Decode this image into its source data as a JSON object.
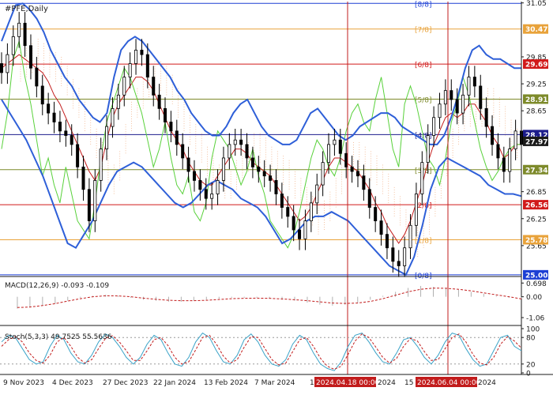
{
  "chart_data": [
    {
      "type": "candlestick",
      "title": "#PFE,Daily",
      "price_axis": [
        31.05,
        30.47,
        29.85,
        29.69,
        29.25,
        28.91,
        28.65,
        28.12,
        27.97,
        27.34,
        26.85,
        26.56,
        26.25,
        25.78,
        25.65,
        25.0
      ],
      "ylim": [
        24.98,
        31.08
      ],
      "dates": [
        "9 Nov 2023",
        "4 Dec 2023",
        "27 Dec 2023",
        "22 Jan 2024",
        "13 Feb 2024",
        "7 Mar 2024",
        "1 Apr 2024",
        "2024.04.18 00:00",
        "2024",
        "15",
        "2024.06.04 00:00",
        "2024"
      ],
      "levels": [
        {
          "label": "[8/8]",
          "value": 31.04,
          "color": "#1c3fd4"
        },
        {
          "label": "[7/8]",
          "value": 30.47,
          "color": "#e8a23a"
        },
        {
          "label": "[6/8]",
          "value": 29.69,
          "color": "#d11a1a"
        },
        {
          "label": "[5/8]",
          "value": 28.91,
          "color": "#7d8a2a"
        },
        {
          "label": "[4/8]",
          "value": 28.12,
          "color": "#1c1c8c"
        },
        {
          "label": "[3/8]",
          "value": 27.34,
          "color": "#7d8a2a"
        },
        {
          "label": "[2/8]",
          "value": 26.56,
          "color": "#d11a1a"
        },
        {
          "label": "[1/8]",
          "value": 25.78,
          "color": "#e8a23a"
        },
        {
          "label": "[0/8]",
          "value": 25.0,
          "color": "#1c3fd4"
        }
      ],
      "price_tags": [
        {
          "value": 30.47,
          "color": "#e8a23a"
        },
        {
          "value": 29.69,
          "color": "#d11a1a"
        },
        {
          "value": 28.91,
          "color": "#7d8a2a"
        },
        {
          "value": 28.12,
          "color": "#1c1c8c"
        },
        {
          "value": 27.97,
          "color": "#1a1a1a"
        },
        {
          "value": 27.34,
          "color": "#7d8a2a"
        },
        {
          "value": 26.56,
          "color": "#d11a1a"
        },
        {
          "value": 25.78,
          "color": "#e8a23a"
        },
        {
          "value": 25.0,
          "color": "#1c3fd4"
        }
      ],
      "plain_ticks": [
        31.05,
        29.85,
        29.25,
        28.65,
        26.85,
        26.25,
        25.65
      ],
      "series": [
        {
          "name": "close",
          "values": [
            29.5,
            29.9,
            30.3,
            30.6,
            30.1,
            29.6,
            29.2,
            28.8,
            28.6,
            28.4,
            28.2,
            28.1,
            27.9,
            27.4,
            26.9,
            26.2,
            27.1,
            27.8,
            28.3,
            28.7,
            29.0,
            29.4,
            29.7,
            30.0,
            29.9,
            29.4,
            29.0,
            28.7,
            28.4,
            28.2,
            27.9,
            27.6,
            27.3,
            27.1,
            26.9,
            26.7,
            26.8,
            27.1,
            27.6,
            27.9,
            28.0,
            27.9,
            27.6,
            27.4,
            27.3,
            27.2,
            27.1,
            26.8,
            26.5,
            26.3,
            26.0,
            25.8,
            26.2,
            26.6,
            27.0,
            27.5,
            27.9,
            28.0,
            27.7,
            27.4,
            27.3,
            27.2,
            26.9,
            26.5,
            26.2,
            25.9,
            25.6,
            25.3,
            25.2,
            25.6,
            26.1,
            26.8,
            27.5,
            28.1,
            28.5,
            28.8,
            29.1,
            28.9,
            28.6,
            29.0,
            29.4,
            29.2,
            28.7,
            28.3,
            27.9,
            27.6,
            27.3,
            27.8,
            28.2,
            27.9
          ]
        },
        {
          "name": "ichimoku",
          "values": [
            29.6,
            29.7,
            29.8,
            29.9,
            29.8,
            29.7,
            29.6,
            29.5,
            29.3,
            29.0,
            28.8,
            28.5,
            28.2,
            27.9,
            27.6,
            27.3,
            27.1,
            27.4,
            28.0,
            28.5,
            28.8,
            29.0,
            29.2,
            29.4,
            29.4,
            29.3,
            29.1,
            28.8,
            28.5,
            28.2,
            28.0,
            27.8,
            27.5,
            27.3,
            27.1,
            27.0,
            27.0,
            27.2,
            27.4,
            27.6,
            27.8,
            27.8,
            27.7,
            27.5,
            27.4,
            27.3,
            27.2,
            27.0,
            26.8,
            26.6,
            26.4,
            26.2,
            26.3,
            26.5,
            26.8,
            27.1,
            27.4,
            27.6,
            27.6,
            27.5,
            27.4,
            27.3,
            27.1,
            26.9,
            26.6,
            26.4,
            26.1,
            25.9,
            25.7,
            25.9,
            26.2,
            26.6,
            27.0,
            27.5,
            27.9,
            28.2,
            28.5,
            28.6,
            28.5,
            28.6,
            28.8,
            28.8,
            28.6,
            28.4,
            28.1,
            27.9,
            27.6,
            27.7,
            27.9,
            27.9
          ]
        },
        {
          "name": "momentum",
          "values": [
            27.8,
            28.6,
            29.8,
            30.2,
            29.4,
            28.8,
            28.0,
            27.2,
            27.6,
            27.0,
            26.6,
            27.4,
            26.8,
            26.2,
            26.0,
            25.8,
            26.6,
            27.6,
            28.4,
            28.8,
            29.2,
            29.6,
            29.4,
            29.0,
            28.6,
            28.0,
            27.4,
            27.8,
            28.4,
            27.6,
            27.0,
            26.8,
            27.2,
            26.4,
            26.2,
            26.6,
            27.6,
            28.2,
            28.0,
            27.8,
            27.4,
            27.0,
            27.3,
            27.8,
            27.2,
            26.8,
            26.2,
            26.0,
            25.8,
            25.6,
            25.9,
            26.4,
            27.0,
            27.6,
            28.0,
            27.8,
            27.4,
            27.2,
            27.6,
            28.2,
            28.6,
            28.8,
            28.4,
            28.2,
            28.9,
            29.4,
            28.6,
            27.8,
            27.4,
            28.8,
            29.2,
            28.8,
            28.2,
            27.6,
            27.4,
            27.0,
            27.6,
            28.4,
            28.8,
            29.4,
            29.0,
            28.4,
            27.8,
            27.4,
            27.1,
            27.3,
            27.6,
            27.8,
            27.9,
            27.9
          ]
        },
        {
          "name": "bollinger_upper",
          "values": [
            30.2,
            30.6,
            31.0,
            31.04,
            30.9,
            30.7,
            30.4,
            30.0,
            29.7,
            29.4,
            29.2,
            28.9,
            28.7,
            28.5,
            28.4,
            28.6,
            29.4,
            30.0,
            30.2,
            30.3,
            30.2,
            30.0,
            29.8,
            29.6,
            29.4,
            29.1,
            28.9,
            28.6,
            28.4,
            28.2,
            28.1,
            28.1,
            28.3,
            28.6,
            28.8,
            28.9,
            28.6,
            28.3,
            28.1,
            28.0,
            27.9,
            27.9,
            28.0,
            28.3,
            28.6,
            28.7,
            28.5,
            28.3,
            28.1,
            28.0,
            28.1,
            28.3,
            28.4,
            28.5,
            28.6,
            28.6,
            28.5,
            28.3,
            28.2,
            28.1,
            28.0,
            27.9,
            27.9,
            28.1,
            28.5,
            29.0,
            29.6,
            30.0,
            30.1,
            29.9,
            29.8,
            29.8,
            29.7,
            29.6,
            29.6
          ]
        },
        {
          "name": "bollinger_lower",
          "values": [
            28.9,
            28.6,
            28.3,
            28.0,
            27.6,
            27.2,
            26.7,
            26.2,
            25.7,
            25.6,
            25.9,
            26.2,
            26.6,
            27.0,
            27.3,
            27.4,
            27.5,
            27.4,
            27.2,
            27.0,
            26.8,
            26.6,
            26.5,
            26.6,
            26.8,
            27.0,
            27.1,
            27.0,
            26.9,
            26.7,
            26.6,
            26.5,
            26.3,
            26.0,
            25.7,
            25.8,
            26.0,
            26.2,
            26.3,
            26.3,
            26.4,
            26.3,
            26.2,
            26.0,
            25.8,
            25.6,
            25.4,
            25.2,
            25.1,
            25.0,
            25.4,
            26.1,
            26.9,
            27.4,
            27.6,
            27.5,
            27.4,
            27.3,
            27.2,
            27.0,
            26.9,
            26.8,
            26.8,
            26.75
          ]
        }
      ]
    },
    {
      "type": "bar",
      "title": "MACD(12,26,9) -0.093 -0.109",
      "axis": [
        0.698,
        0.0,
        -1.06
      ],
      "ylim": [
        -1.3,
        0.95
      ],
      "series": [
        {
          "name": "histogram",
          "values": [
            -0.6,
            -0.55,
            -0.45,
            -0.35,
            -0.2,
            -0.05,
            0.05,
            0.1,
            0.05,
            -0.05,
            -0.15,
            -0.2,
            -0.25,
            -0.25,
            -0.2,
            -0.15,
            -0.1,
            -0.05,
            -0.05,
            -0.05,
            -0.1,
            -0.15,
            -0.2,
            -0.3,
            -0.4,
            -0.45,
            -0.4,
            -0.3,
            -0.15,
            0.05,
            0.25,
            0.45,
            0.55,
            0.5,
            0.45,
            0.35,
            0.25,
            0.15,
            0.05,
            -0.05,
            -0.09
          ]
        },
        {
          "name": "signal",
          "values": [
            -0.55,
            -0.52,
            -0.45,
            -0.35,
            -0.22,
            -0.1,
            0.0,
            0.05,
            0.04,
            0.0,
            -0.07,
            -0.13,
            -0.18,
            -0.2,
            -0.2,
            -0.18,
            -0.14,
            -0.1,
            -0.08,
            -0.07,
            -0.08,
            -0.11,
            -0.15,
            -0.2,
            -0.26,
            -0.32,
            -0.34,
            -0.32,
            -0.24,
            -0.1,
            0.08,
            0.25,
            0.38,
            0.44,
            0.43,
            0.38,
            0.3,
            0.2,
            0.1,
            0.0,
            -0.11
          ]
        }
      ]
    },
    {
      "type": "line",
      "title": "Stoch(5,3,3) 49.7525 55.5636",
      "axis": [
        100,
        80,
        20,
        0
      ],
      "ylim": [
        0,
        100
      ],
      "series": [
        {
          "name": "%K",
          "values": [
            70,
            85,
            80,
            55,
            30,
            20,
            25,
            60,
            85,
            75,
            45,
            25,
            20,
            40,
            70,
            88,
            80,
            60,
            35,
            20,
            35,
            65,
            85,
            75,
            45,
            20,
            15,
            35,
            70,
            90,
            80,
            50,
            25,
            20,
            40,
            75,
            88,
            70,
            40,
            20,
            15,
            30,
            65,
            85,
            75,
            45,
            20,
            10,
            5,
            25,
            60,
            85,
            90,
            70,
            45,
            25,
            20,
            45,
            75,
            80,
            60,
            35,
            20,
            40,
            70,
            90,
            85,
            55,
            30,
            15,
            20,
            50,
            80,
            85,
            60,
            50
          ]
        },
        {
          "name": "%D",
          "values": [
            60,
            75,
            82,
            70,
            45,
            28,
            22,
            40,
            70,
            80,
            60,
            35,
            22,
            30,
            55,
            78,
            84,
            70,
            50,
            28,
            28,
            50,
            75,
            80,
            62,
            35,
            20,
            25,
            52,
            80,
            85,
            65,
            38,
            22,
            30,
            58,
            82,
            80,
            55,
            30,
            18,
            22,
            48,
            75,
            80,
            60,
            33,
            15,
            8,
            15,
            42,
            72,
            88,
            80,
            58,
            35,
            22,
            33,
            60,
            78,
            72,
            48,
            28,
            30,
            55,
            80,
            88,
            70,
            42,
            22,
            18,
            35,
            65,
            82,
            72,
            56
          ]
        }
      ]
    }
  ]
}
